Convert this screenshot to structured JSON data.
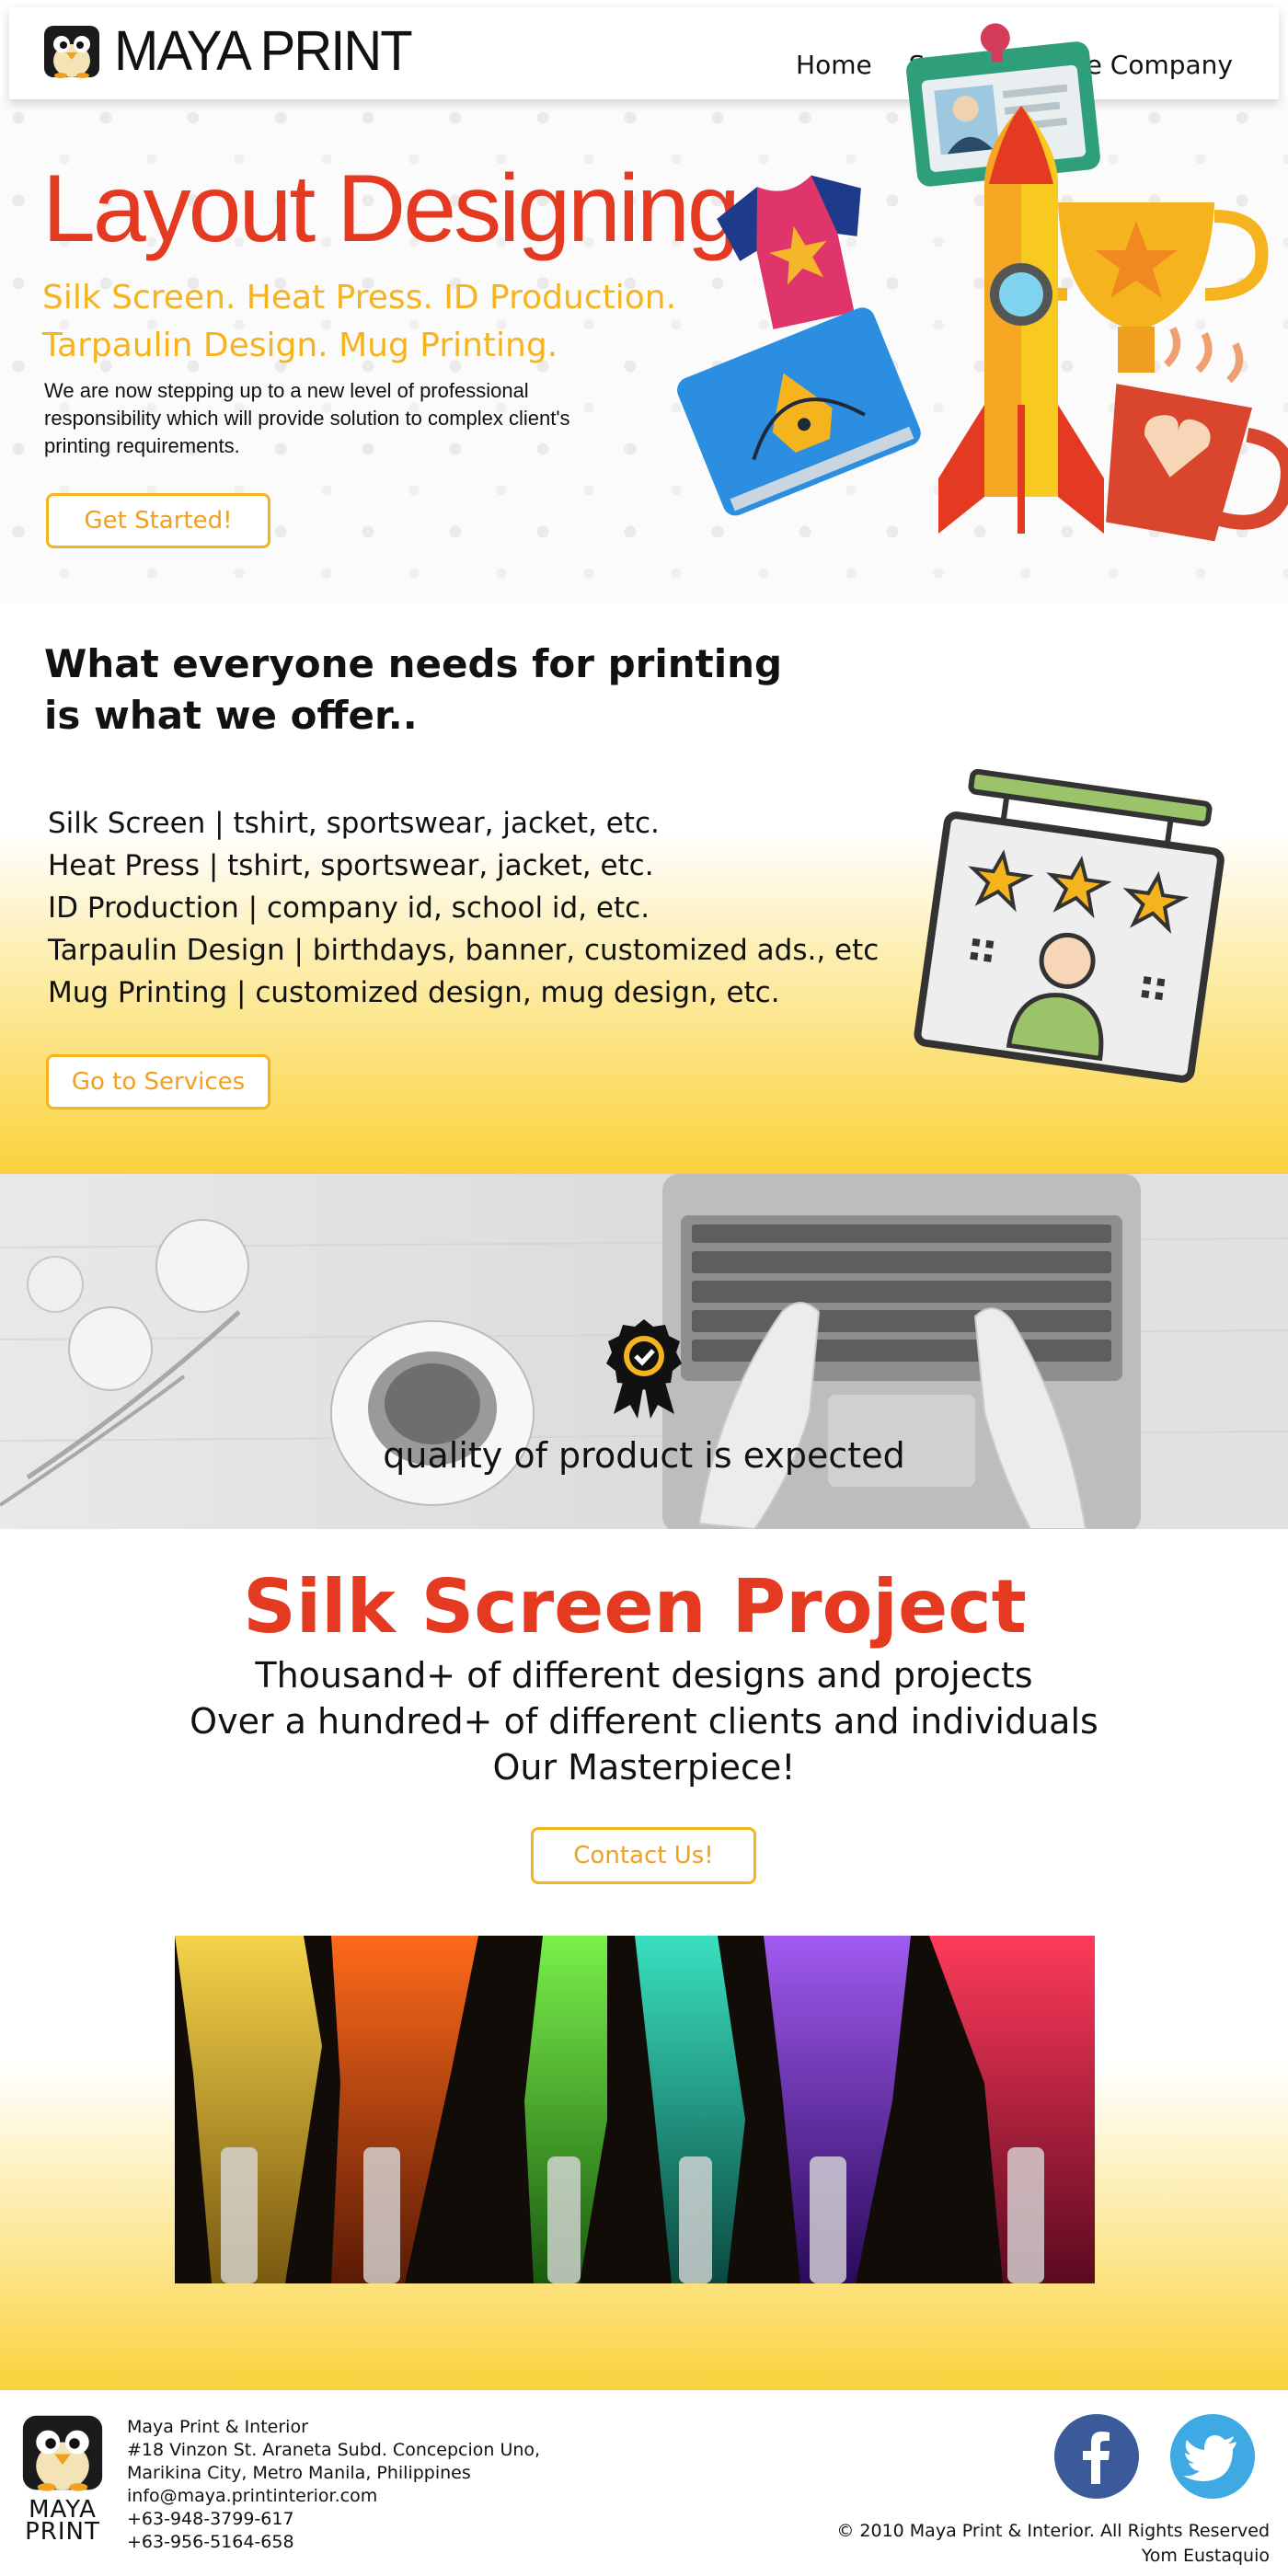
{
  "header": {
    "brand": "MAYA PRINT",
    "nav": [
      {
        "label": "Home"
      },
      {
        "label": "Services"
      },
      {
        "label": "The Company"
      }
    ]
  },
  "hero": {
    "title": "Layout Designing",
    "subtitle_line1": "Silk Screen. Heat Press. ID Production.",
    "subtitle_line2": "Tarpaulin Design. Mug Printing.",
    "text": "We are now stepping up to a new level of professional responsibility which will provide solution to complex client's printing requirements.",
    "cta": "Get Started!"
  },
  "services": {
    "heading": "What everyone needs for printing is what we offer..",
    "items": [
      "Silk Screen | tshirt, sportswear, jacket, etc.",
      "Heat Press | tshirt, sportswear, jacket, etc.",
      "ID Production | company id, school id, etc.",
      "Tarpaulin Design | birthdays, banner, customized ads., etc",
      "Mug Printing | customized design, mug design, etc."
    ],
    "cta": "Go to Services"
  },
  "quality": {
    "tagline": "quality of product is expected"
  },
  "project": {
    "title": "Silk Screen Project",
    "lines": [
      "Thousand+ of different designs and projects",
      "Over a hundred+ of different clients and individuals",
      "Our Masterpiece!"
    ],
    "cta": "Contact Us!"
  },
  "footer": {
    "logo_line1": "MAYA",
    "logo_line2": "PRINT",
    "company": "Maya Print & Interior",
    "address1": "#18 Vinzon St. Araneta Subd. Concepcion Uno,",
    "address2": "Marikina City, Metro Manila, Philippines",
    "email": "info@maya.printinterior.com",
    "phone1": "+63-948-3799-617",
    "phone2": "+63-956-5164-658",
    "copyright": "© 2010 Maya Print & Interior. All Rights Reserved",
    "author": "Yom Eustaquio"
  },
  "colors": {
    "accent_red": "#e43a21",
    "accent_yellow": "#f5b41e",
    "facebook": "#3a5a99",
    "twitter": "#3fa9e3"
  }
}
